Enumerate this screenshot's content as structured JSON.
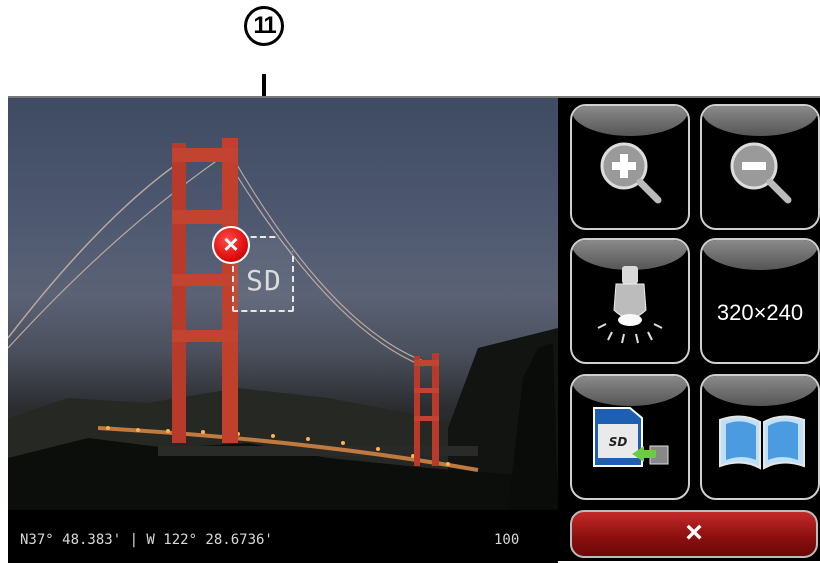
{
  "callout": {
    "number": "11"
  },
  "photo": {
    "subject": ""
  },
  "status": {
    "coordinates": "N37° 48.383' | W 122° 28.6736'",
    "count": "100"
  },
  "sd_warning": {
    "card_label": "SD",
    "badge_symbol": "×",
    "badge_icon": "error-x-icon"
  },
  "buttons": {
    "zoom_in": {
      "icon": "zoom-in-icon"
    },
    "zoom_out": {
      "icon": "zoom-out-icon"
    },
    "flash": {
      "icon": "flashlight-icon"
    },
    "resolution": {
      "label": "320×240"
    },
    "sd_copy": {
      "icon": "sd-card-icon"
    },
    "album": {
      "icon": "book-icon"
    },
    "close": {
      "label": "×",
      "icon": "close-icon"
    }
  },
  "colors": {
    "accent_red": "#c42a2a",
    "frame": "#000000",
    "button_border": "#cfcfcf"
  }
}
